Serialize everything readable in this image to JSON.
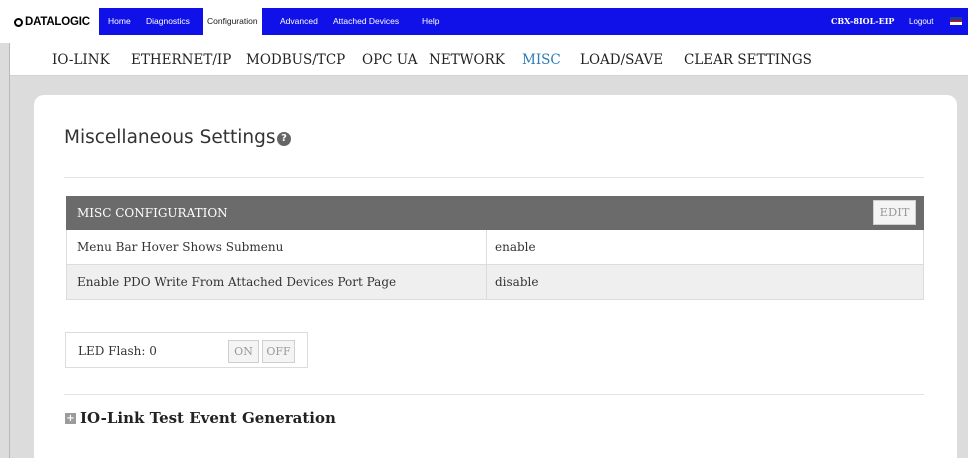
{
  "logo": {
    "text": "DATALOGIC"
  },
  "nav": {
    "items": [
      {
        "label": "Home"
      },
      {
        "label": "Diagnostics"
      },
      {
        "label": "Configuration",
        "active": true
      },
      {
        "label": "Advanced"
      },
      {
        "label": "Attached Devices"
      },
      {
        "label": "Help"
      }
    ],
    "device": "CBX-8IOL-EIP",
    "logout": "Logout",
    "flag_icon": "us-flag-icon"
  },
  "subnav": {
    "items": [
      {
        "label": "IO-LINK"
      },
      {
        "label": "ETHERNET/IP"
      },
      {
        "label": "MODBUS/TCP"
      },
      {
        "label": "OPC UA"
      },
      {
        "label": "NETWORK"
      },
      {
        "label": "MISC",
        "active": true
      },
      {
        "label": "LOAD/SAVE"
      },
      {
        "label": "CLEAR SETTINGS"
      }
    ]
  },
  "page": {
    "title": "Miscellaneous Settings",
    "help_icon": "?"
  },
  "misc_config": {
    "header": "MISC CONFIGURATION",
    "edit_label": "EDIT",
    "rows": [
      {
        "name": "Menu Bar Hover Shows Submenu",
        "value": "enable"
      },
      {
        "name": "Enable PDO Write From Attached Devices Port Page",
        "value": "disable"
      }
    ]
  },
  "led": {
    "label": "LED Flash: 0",
    "on_label": "ON",
    "off_label": "OFF"
  },
  "test_event": {
    "expand_icon": "+",
    "title": "IO-Link Test Event Generation"
  },
  "colors": {
    "nav_bg": "#1010e8",
    "active_subnav": "#2b7bb9",
    "table_header": "#6b6b6b"
  }
}
